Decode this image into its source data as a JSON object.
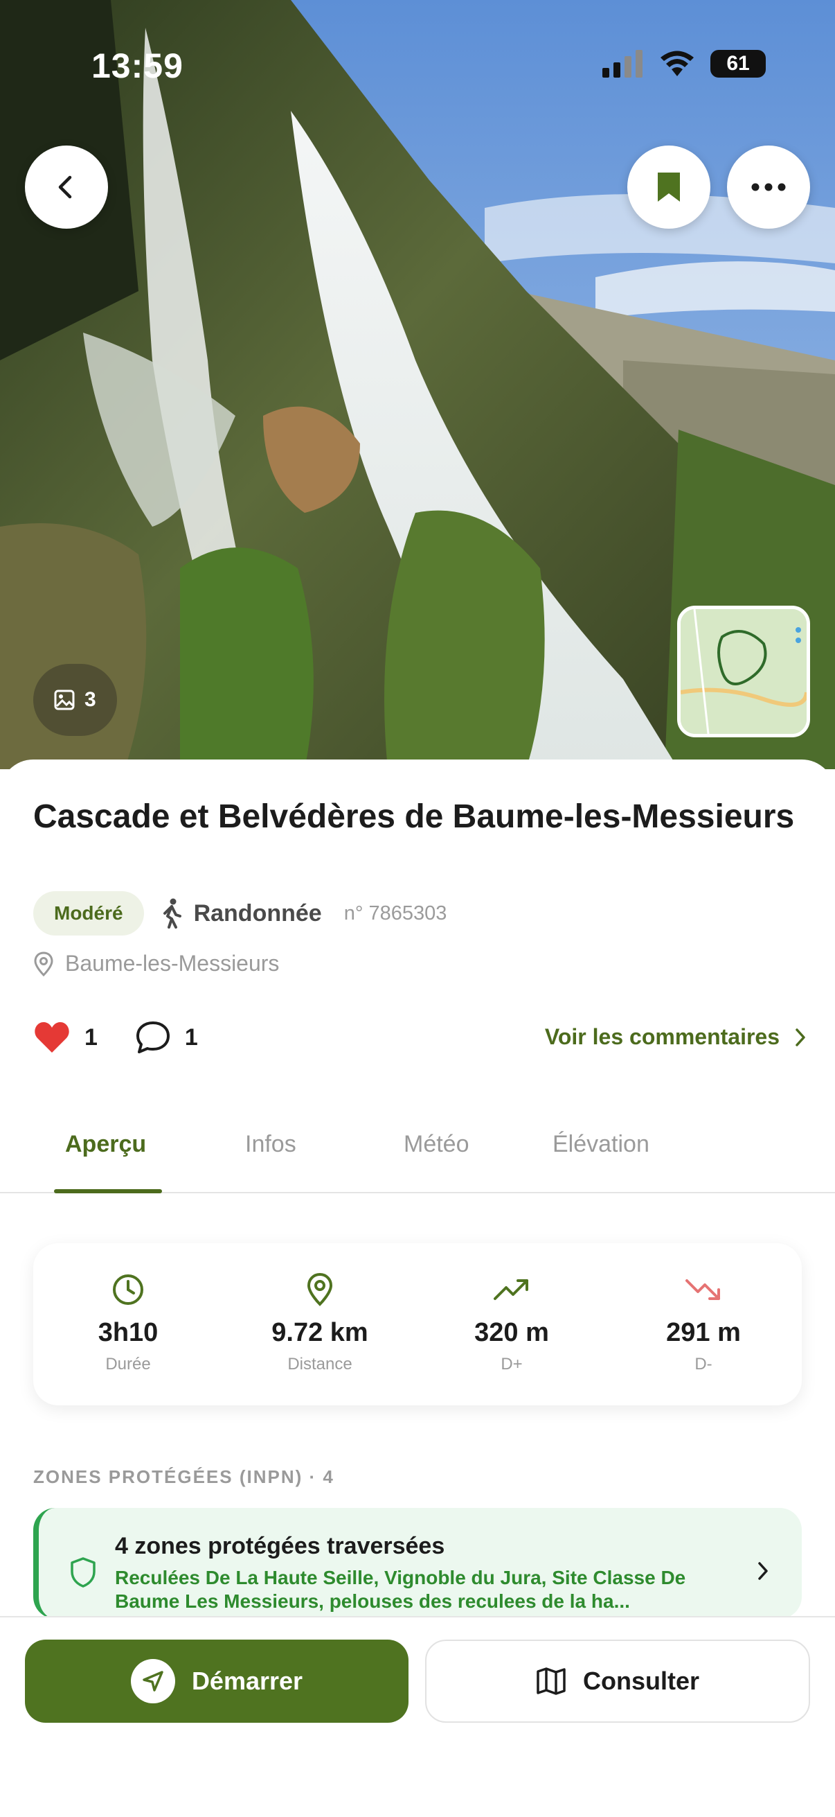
{
  "status_bar": {
    "time": "13:59",
    "battery": "61"
  },
  "hero": {
    "photo_count": "3"
  },
  "route": {
    "title": "Cascade et Belvédères de Baume-les-Messieurs",
    "difficulty": "Modéré",
    "activity": "Randonnée",
    "number": "n° 7865303",
    "location": "Baume-les-Messieurs"
  },
  "social": {
    "likes": "1",
    "comments": "1",
    "comments_link": "Voir les commentaires"
  },
  "tabs": [
    "Aperçu",
    "Infos",
    "Météo",
    "Élévation"
  ],
  "stats": [
    {
      "value": "3h10",
      "label": "Durée",
      "icon": "clock-icon"
    },
    {
      "value": "9.72 km",
      "label": "Distance",
      "icon": "location-pin-icon"
    },
    {
      "value": "320 m",
      "label": "D+",
      "icon": "trending-up-icon"
    },
    {
      "value": "291 m",
      "label": "D-",
      "icon": "trending-down-icon"
    }
  ],
  "zones": {
    "section_title": "ZONES PROTÉGÉES (INPN) · 4",
    "card_title": "4 zones protégées traversées",
    "card_desc": "Reculées De La Haute Seille, Vignoble du Jura, Site Classe De Baume Les Messieurs, pelouses des reculees de la ha..."
  },
  "actions": {
    "start": "Démarrer",
    "consult": "Consulter"
  },
  "colors": {
    "brand_green": "#4f7320",
    "accent_green": "#4c6b1d",
    "zone_green": "#2ea44f",
    "like_red": "#e53935",
    "descent_red": "#e57373"
  }
}
